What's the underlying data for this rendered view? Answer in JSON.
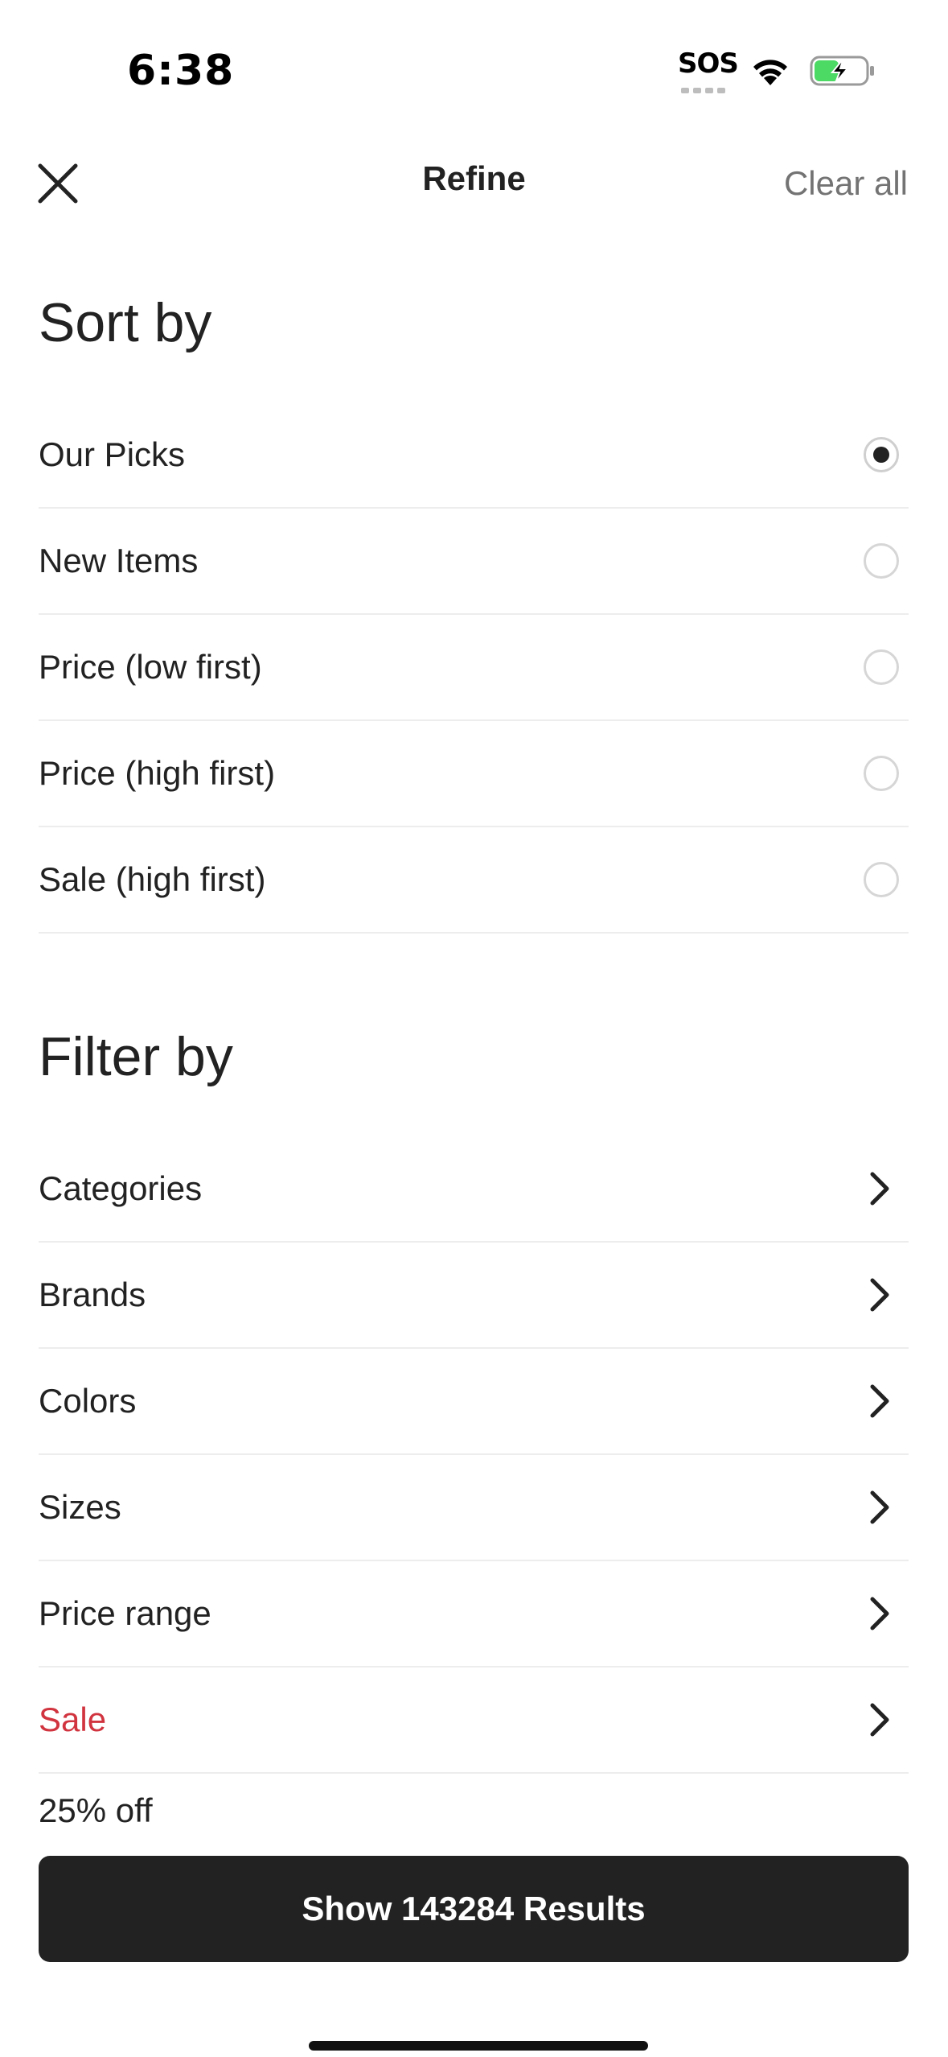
{
  "status_bar": {
    "time": "6:38",
    "sos_label": "SOS",
    "icons": [
      "wifi-icon",
      "battery-charging-icon"
    ],
    "battery_accent": "#4cd964"
  },
  "header": {
    "title": "Refine",
    "clear_all": "Clear all",
    "close_icon": "close-icon"
  },
  "sort": {
    "title": "Sort by",
    "options": [
      {
        "label": "Our Picks",
        "selected": true
      },
      {
        "label": "New Items",
        "selected": false
      },
      {
        "label": "Price (low first)",
        "selected": false
      },
      {
        "label": "Price (high first)",
        "selected": false
      },
      {
        "label": "Sale (high first)",
        "selected": false
      }
    ]
  },
  "filter": {
    "title": "Filter by",
    "items": [
      {
        "label": "Categories"
      },
      {
        "label": "Brands"
      },
      {
        "label": "Colors"
      },
      {
        "label": "Sizes"
      },
      {
        "label": "Price range"
      },
      {
        "label": "Sale",
        "highlight_color": "#d1343f"
      }
    ],
    "partial_item": "25% off"
  },
  "footer": {
    "results_button": "Show 143284 Results"
  }
}
